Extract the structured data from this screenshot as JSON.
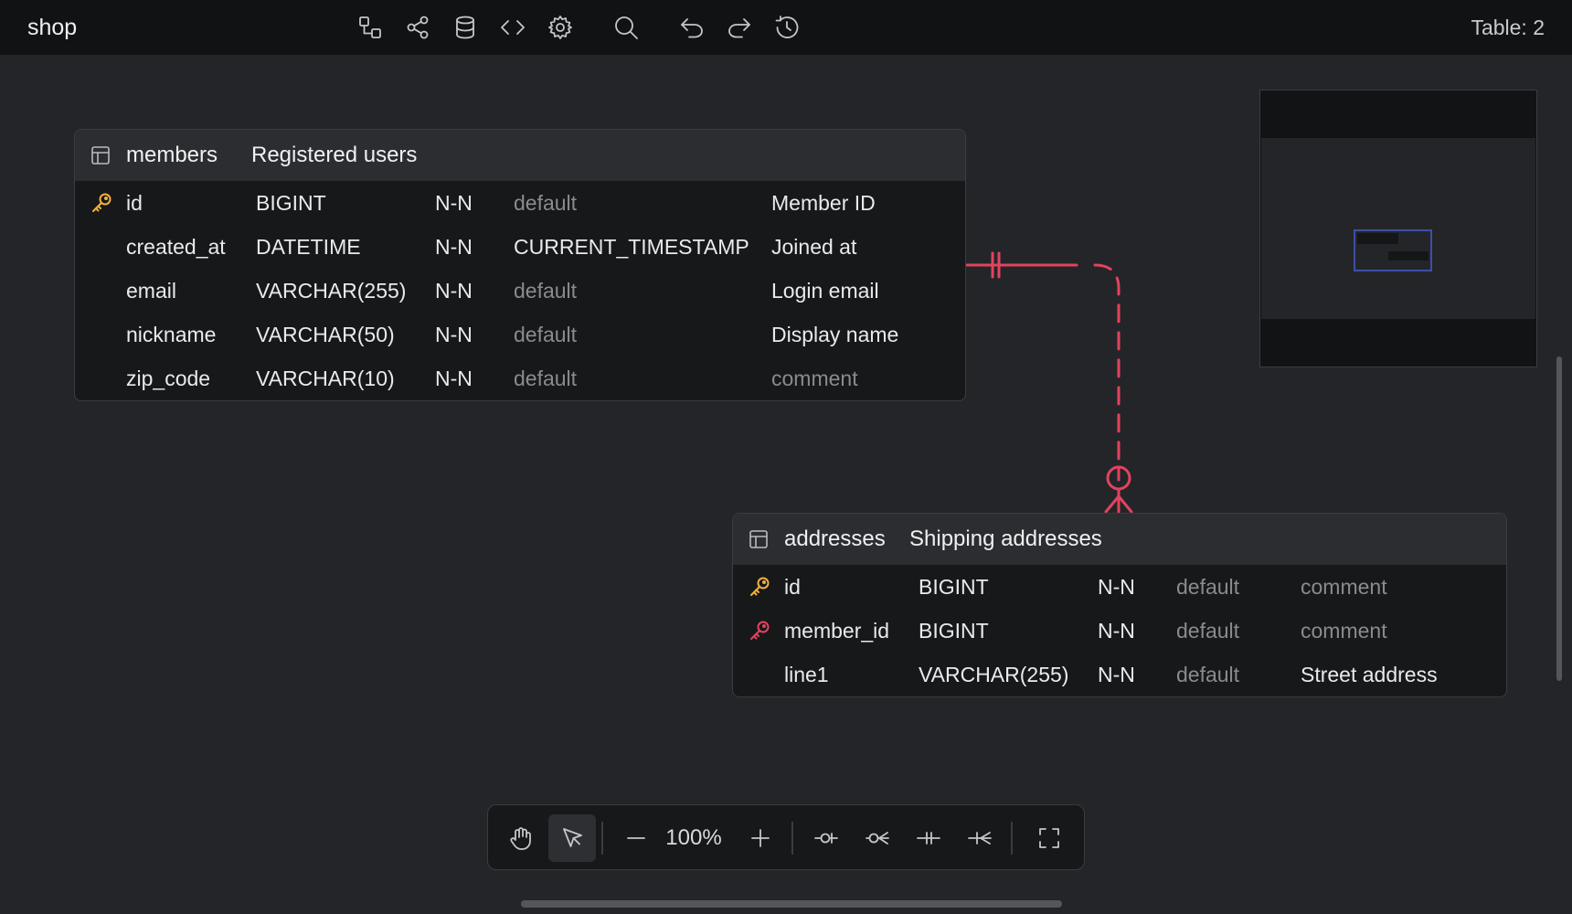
{
  "header": {
    "app_title": "shop",
    "table_count": "Table: 2",
    "icons": [
      "relationship-icon",
      "share-icon",
      "database-icon",
      "code-icon",
      "settings-icon",
      "search-icon",
      "undo-icon",
      "redo-icon",
      "history-icon"
    ]
  },
  "tables": [
    {
      "name": "members",
      "comment": "Registered users",
      "columns": [
        {
          "key": "primary",
          "name": "id",
          "type": "BIGINT",
          "null": "N-N",
          "default": "default",
          "default_placeholder": true,
          "comment": "Member ID",
          "comment_placeholder": false
        },
        {
          "key": "",
          "name": "created_at",
          "type": "DATETIME",
          "null": "N-N",
          "default": "CURRENT_TIMESTAMP",
          "default_placeholder": false,
          "comment": "Joined at",
          "comment_placeholder": false
        },
        {
          "key": "",
          "name": "email",
          "type": "VARCHAR(255)",
          "null": "N-N",
          "default": "default",
          "default_placeholder": true,
          "comment": "Login email",
          "comment_placeholder": false
        },
        {
          "key": "",
          "name": "nickname",
          "type": "VARCHAR(50)",
          "null": "N-N",
          "default": "default",
          "default_placeholder": true,
          "comment": "Display name",
          "comment_placeholder": false
        },
        {
          "key": "",
          "name": "zip_code",
          "type": "VARCHAR(10)",
          "null": "N-N",
          "default": "default",
          "default_placeholder": true,
          "comment": "comment",
          "comment_placeholder": true
        }
      ]
    },
    {
      "name": "addresses",
      "comment": "Shipping addresses",
      "columns": [
        {
          "key": "primary",
          "name": "id",
          "type": "BIGINT",
          "null": "N-N",
          "default": "default",
          "default_placeholder": true,
          "comment": "comment",
          "comment_placeholder": true
        },
        {
          "key": "foreign",
          "name": "member_id",
          "type": "BIGINT",
          "null": "N-N",
          "default": "default",
          "default_placeholder": true,
          "comment": "comment",
          "comment_placeholder": true
        },
        {
          "key": "",
          "name": "line1",
          "type": "VARCHAR(255)",
          "null": "N-N",
          "default": "default",
          "default_placeholder": true,
          "comment": "Street address",
          "comment_placeholder": false
        }
      ]
    }
  ],
  "toolbar": {
    "zoom": "100%",
    "buttons": [
      "hand-icon",
      "pointer-icon",
      "zoom-out-icon",
      "zoom-in-icon",
      "zero-one-icon",
      "zero-many-icon",
      "one-one-icon",
      "one-many-icon",
      "fullscreen-icon"
    ]
  },
  "colors": {
    "background": "#242528",
    "topbar": "#111214",
    "primary_key": "#f2b13c",
    "foreign_key": "#e2435f",
    "relation": "#e2435f",
    "minimap_viewport": "#3e4fa8"
  }
}
